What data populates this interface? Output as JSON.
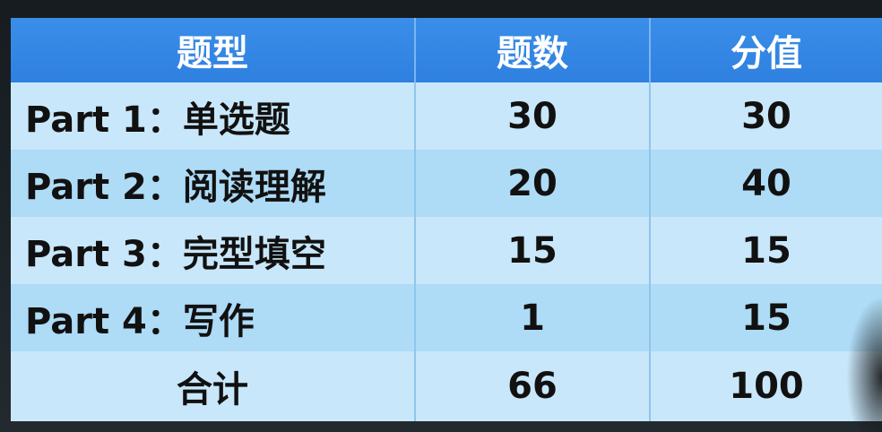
{
  "table": {
    "headers": [
      "题型",
      "题数",
      "分值"
    ],
    "rows": [
      {
        "type": "Part 1：单选题",
        "count": "30",
        "score": "30"
      },
      {
        "type": "Part 2：阅读理解",
        "count": "20",
        "score": "40"
      },
      {
        "type": "Part 3：完型填空",
        "count": "15",
        "score": "15"
      },
      {
        "type": "Part 4：写作",
        "count": "1",
        "score": "15"
      }
    ],
    "total": {
      "label": "合计",
      "count": "66",
      "score": "100"
    }
  },
  "colors": {
    "header_bg": "#2f80e0",
    "row_light": "#c9e7fa",
    "row_dark": "#aedbf6"
  }
}
